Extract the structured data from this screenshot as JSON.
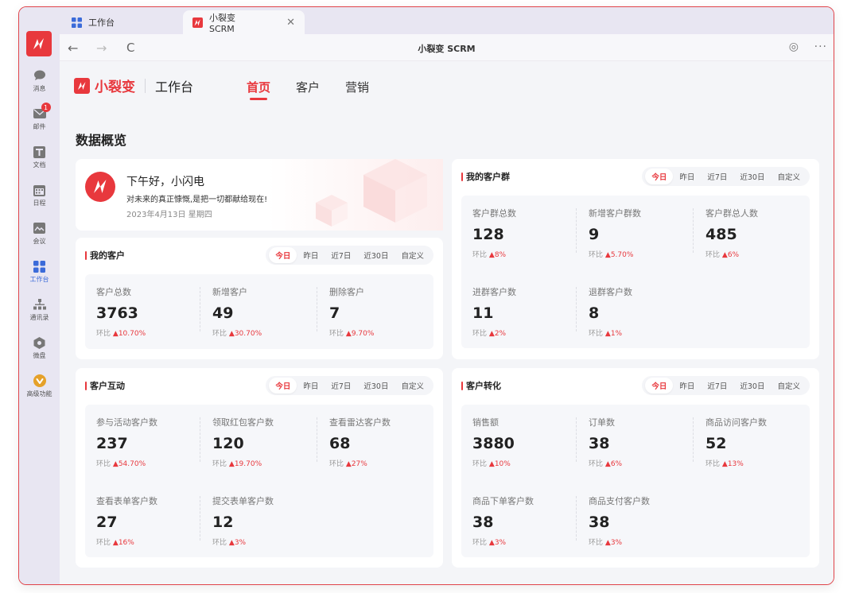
{
  "rail": {
    "items": [
      {
        "label": "消息",
        "icon": "chat-icon"
      },
      {
        "label": "邮件",
        "icon": "mail-icon",
        "badge": "1"
      },
      {
        "label": "文档",
        "icon": "doc-icon"
      },
      {
        "label": "日程",
        "icon": "calendar-icon"
      },
      {
        "label": "会议",
        "icon": "meeting-icon"
      },
      {
        "label": "工作台",
        "icon": "workbench-icon"
      },
      {
        "label": "通讯录",
        "icon": "contacts-icon"
      },
      {
        "label": "微盘",
        "icon": "drive-icon"
      },
      {
        "label": "高级功能",
        "icon": "premium-icon"
      }
    ]
  },
  "tabs": [
    {
      "label": "工作台",
      "icon": "grid-icon"
    },
    {
      "label": "小裂变SCRM",
      "icon": "brand-icon",
      "close": "✕"
    }
  ],
  "addressbar": {
    "title": "小裂变 SCRM",
    "back": "←",
    "forward": "→",
    "reload": "C",
    "settings": "◎",
    "more": "···"
  },
  "topnav": {
    "brand": "小裂变",
    "sub": "工作台",
    "links": [
      "首页",
      "客户",
      "营销"
    ]
  },
  "section_title": "数据概览",
  "greeting": {
    "title": "下午好，小闪电",
    "subtitle": "对未来的真正慷慨,是把一切都献给现在!",
    "date": "2023年4月13日  星期四"
  },
  "ranges": [
    "今日",
    "昨日",
    "近7日",
    "近30日",
    "自定义"
  ],
  "cards": {
    "my_customers": {
      "title": "我的客户",
      "stats": [
        {
          "label": "客户总数",
          "value": "3763",
          "ratio_label": "环比",
          "ratio": "10.70%"
        },
        {
          "label": "新增客户",
          "value": "49",
          "ratio_label": "环比",
          "ratio": "30.70%"
        },
        {
          "label": "删除客户",
          "value": "7",
          "ratio_label": "环比",
          "ratio": "9.70%"
        }
      ]
    },
    "my_groups": {
      "title": "我的客户群",
      "stats": [
        {
          "label": "客户群总数",
          "value": "128",
          "ratio_label": "环比",
          "ratio": "8%"
        },
        {
          "label": "新增客户群数",
          "value": "9",
          "ratio_label": "环比",
          "ratio": "5.70%"
        },
        {
          "label": "客户群总人数",
          "value": "485",
          "ratio_label": "环比",
          "ratio": "6%"
        },
        {
          "label": "进群客户数",
          "value": "11",
          "ratio_label": "环比",
          "ratio": "2%"
        },
        {
          "label": "退群客户数",
          "value": "8",
          "ratio_label": "环比",
          "ratio": "1%"
        }
      ]
    },
    "interaction": {
      "title": "客户互动",
      "stats": [
        {
          "label": "参与活动客户数",
          "value": "237",
          "ratio_label": "环比",
          "ratio": "54.70%"
        },
        {
          "label": "领取红包客户数",
          "value": "120",
          "ratio_label": "环比",
          "ratio": "19.70%"
        },
        {
          "label": "查看雷达客户数",
          "value": "68",
          "ratio_label": "环比",
          "ratio": "27%"
        },
        {
          "label": "查看表单客户数",
          "value": "27",
          "ratio_label": "环比",
          "ratio": "16%"
        },
        {
          "label": "提交表单客户数",
          "value": "12",
          "ratio_label": "环比",
          "ratio": "3%"
        }
      ]
    },
    "conversion": {
      "title": "客户转化",
      "stats": [
        {
          "label": "销售额",
          "value": "3880",
          "ratio_label": "环比",
          "ratio": "10%"
        },
        {
          "label": "订单数",
          "value": "38",
          "ratio_label": "环比",
          "ratio": "6%"
        },
        {
          "label": "商品访问客户数",
          "value": "52",
          "ratio_label": "环比",
          "ratio": "13%"
        },
        {
          "label": "商品下单客户数",
          "value": "38",
          "ratio_label": "环比",
          "ratio": "3%"
        },
        {
          "label": "商品支付客户数",
          "value": "38",
          "ratio_label": "环比",
          "ratio": "3%"
        }
      ]
    }
  },
  "colors": {
    "accent": "#e8383d",
    "active_nav": "#3b6bd9"
  }
}
